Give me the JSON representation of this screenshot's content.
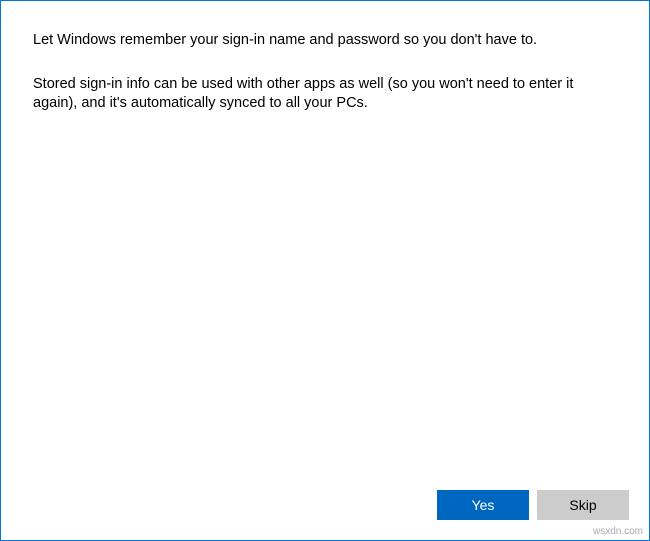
{
  "content": {
    "paragraph1": "Let Windows remember your sign-in name and password so you don't have to.",
    "paragraph2": "Stored sign-in info can be used with other apps as well (so you won't need to enter it again), and it's automatically synced to all your PCs."
  },
  "buttons": {
    "primary": "Yes",
    "secondary": "Skip"
  },
  "watermark": "wsxdn.com"
}
